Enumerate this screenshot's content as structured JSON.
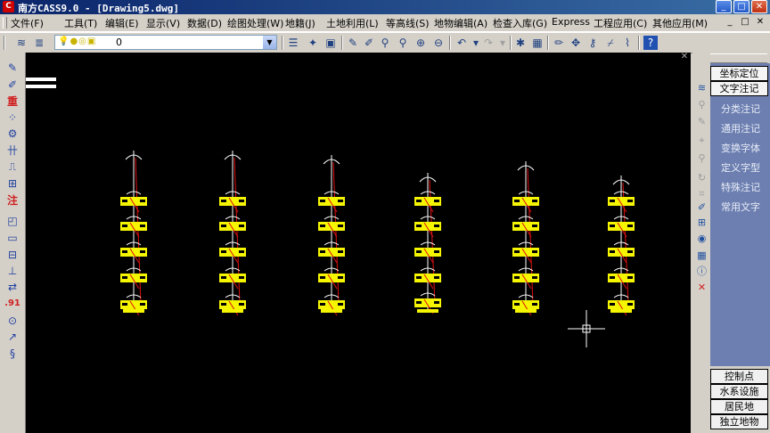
{
  "window": {
    "title": "南方CASS9.0 - [Drawing5.dwg]",
    "app_icon": "cass-icon",
    "buttons": {
      "minimize": "_",
      "maximize": "□",
      "close": "✕"
    }
  },
  "menubar": {
    "items": [
      "文件(F)",
      "工具(T)",
      "编辑(E)",
      "显示(V)",
      "数据(D)",
      "绘图处理(W)",
      "地籍(J)",
      "土地利用(L)",
      "等高线(S)",
      "地物编辑(A)",
      "检查入库(G)",
      "Express",
      "工程应用(C)",
      "其他应用(M)"
    ],
    "doc_buttons": {
      "minimize": "_",
      "restore": "□",
      "close": "✕"
    }
  },
  "toolbar": {
    "layer_state_icons": "💡●◎▣",
    "layer_name": "0"
  },
  "right_panel": {
    "top_buttons": [
      "坐标定位",
      "文字注记"
    ],
    "menu_items": [
      "分类注记",
      "通用注记",
      "变换字体",
      "定义字型",
      "特殊注记",
      "常用文字"
    ],
    "category_buttons": [
      "控制点",
      "水系设施",
      "居民地",
      "独立地物"
    ]
  },
  "left_toolbar": {
    "items": [
      "✎",
      "✐",
      "重",
      "⁘",
      "⚙",
      "卄",
      "⎍",
      "⊞",
      "注",
      "◰",
      "▭",
      "⊟",
      "⊥",
      "⇄",
      ".91",
      "⊙",
      "↗",
      "§"
    ]
  },
  "colors": {
    "canvas_bg": "#000000",
    "title_bar": "#0a246a",
    "right_panel_menu": "#6c7fb0",
    "drawing_yellow": "#f5f500",
    "drawing_red": "#e01010"
  }
}
